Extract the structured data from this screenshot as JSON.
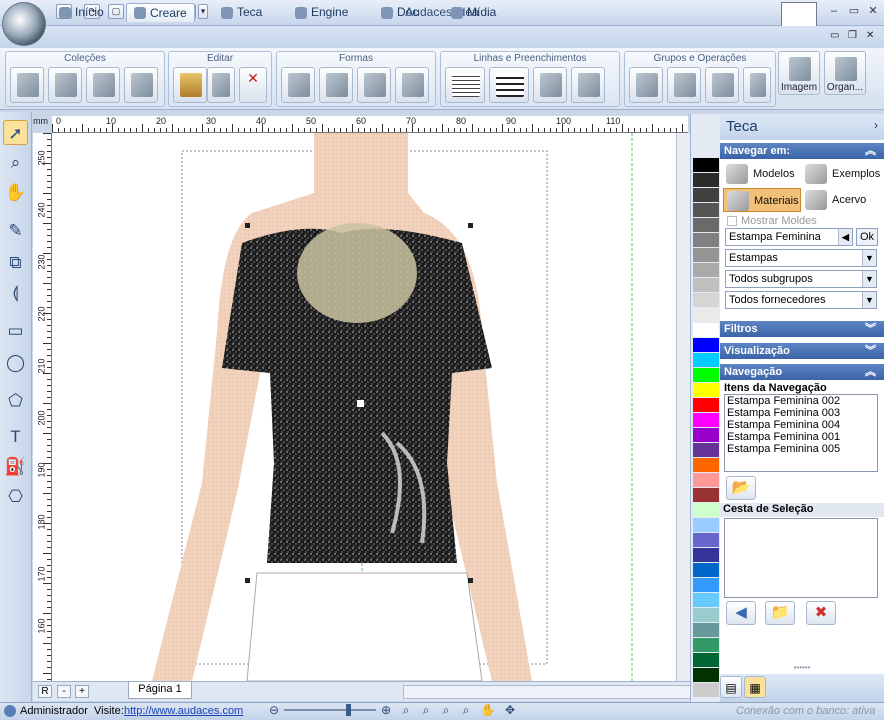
{
  "app": {
    "title": "Audaces Idea"
  },
  "quick_access": [
    "new",
    "open",
    "save",
    "print",
    "help"
  ],
  "tabs": [
    {
      "label": "Início",
      "icon": "home-icon"
    },
    {
      "label": "Creare",
      "icon": "creare-icon",
      "active": true
    },
    {
      "label": "Teca",
      "icon": "teca-icon"
    },
    {
      "label": "Engine",
      "icon": "engine-icon"
    },
    {
      "label": "Doc",
      "icon": "doc-icon"
    },
    {
      "label": "Mídia",
      "icon": "media-icon"
    }
  ],
  "ribbon": {
    "groups": [
      {
        "title": "Coleções"
      },
      {
        "title": "Editar"
      },
      {
        "title": "Formas"
      },
      {
        "title": "Linhas e Preenchimentos"
      },
      {
        "title": "Grupos e Operações"
      }
    ],
    "buttons": {
      "imagem": "Imagem",
      "organ": "Organ..."
    }
  },
  "ruler": {
    "unit": "mm",
    "h_labels": [
      "0",
      "10",
      "20",
      "30",
      "40",
      "50",
      "60",
      "70",
      "80",
      "90",
      "100",
      "110"
    ],
    "v_labels": [
      "250",
      "240",
      "230",
      "220",
      "210",
      "200",
      "190",
      "180",
      "170",
      "160"
    ]
  },
  "document": {
    "page_tab": "Página 1"
  },
  "palette": {
    "colors": [
      "#000000",
      "#2b2b2b",
      "#404040",
      "#555555",
      "#6a6a6a",
      "#808080",
      "#959595",
      "#aaaaaa",
      "#c0c0c0",
      "#d5d5d5",
      "#eaeaea",
      "#ffffff",
      "#0000ff",
      "#00ccff",
      "#00ff00",
      "#ffff00",
      "#ff0000",
      "#ff00ff",
      "#9900cc",
      "#663399",
      "#ff6600",
      "#ff9999",
      "#993333",
      "#ccffcc",
      "#99ccff",
      "#6666cc",
      "#333399",
      "#0066cc",
      "#3399ff",
      "#66ccff",
      "#99cccc",
      "#669999",
      "#339966",
      "#006633",
      "#003300",
      "#cccccc"
    ]
  },
  "panel": {
    "title": "Teca",
    "navegar_em": "Navegar em:",
    "nav_buttons": {
      "modelos": "Modelos",
      "exemplos": "Exemplos",
      "materiais": "Materiais",
      "acervo": "Acervo"
    },
    "mostrar_moldes": "Mostrar Moldes",
    "search_value": "Estampa Feminina",
    "ok": "Ok",
    "combos": {
      "estampas": "Estampas",
      "subgrupos": "Todos subgrupos",
      "fornecedores": "Todos fornecedores"
    },
    "filtros": "Filtros",
    "visualizacao": "Visualização",
    "navegacao": "Navegação",
    "itens_title": "Itens da Navegação",
    "itens": [
      "Estampa Feminina 002",
      "Estampa Feminina 003",
      "Estampa Feminina 004",
      "Estampa Feminina 001",
      "Estampa Feminina 005"
    ],
    "cesta_title": "Cesta de Seleção"
  },
  "status": {
    "user": "Administrador",
    "visite_label": "Visite:",
    "url": "http://www.audaces.com",
    "connection": "Conexão com o banco: ativa"
  }
}
